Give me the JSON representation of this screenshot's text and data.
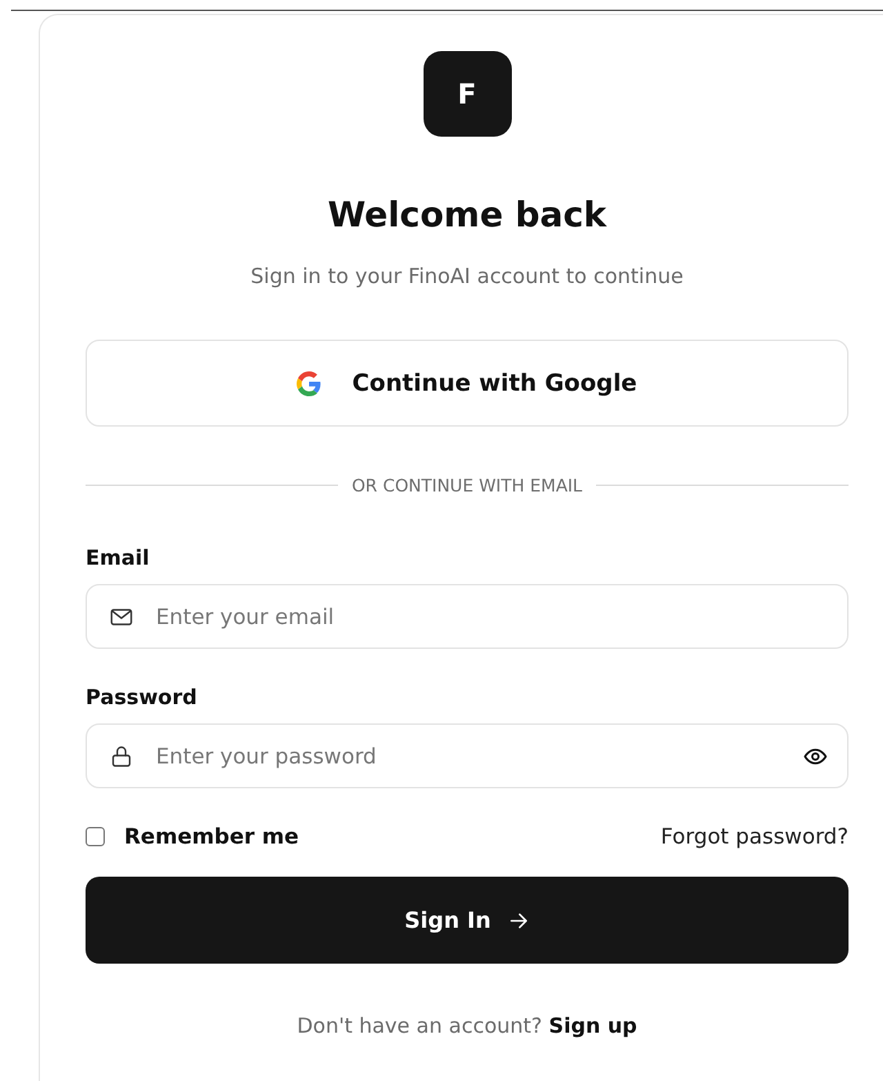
{
  "logo": {
    "letter": "F"
  },
  "title": "Welcome back",
  "subtitle": "Sign in to your FinoAI account to continue",
  "google_button": {
    "label": "Continue with Google"
  },
  "divider": "OR CONTINUE WITH EMAIL",
  "fields": [
    {
      "kind": "email",
      "label": "Email",
      "placeholder": "Enter your email"
    },
    {
      "kind": "password",
      "label": "Password",
      "placeholder": "Enter your password"
    }
  ],
  "remember": {
    "label": "Remember me",
    "checked": false
  },
  "forgot_link": "Forgot password?",
  "submit": {
    "label": "Sign In"
  },
  "footer": {
    "text": "Don't have an account?",
    "link": "Sign up"
  }
}
